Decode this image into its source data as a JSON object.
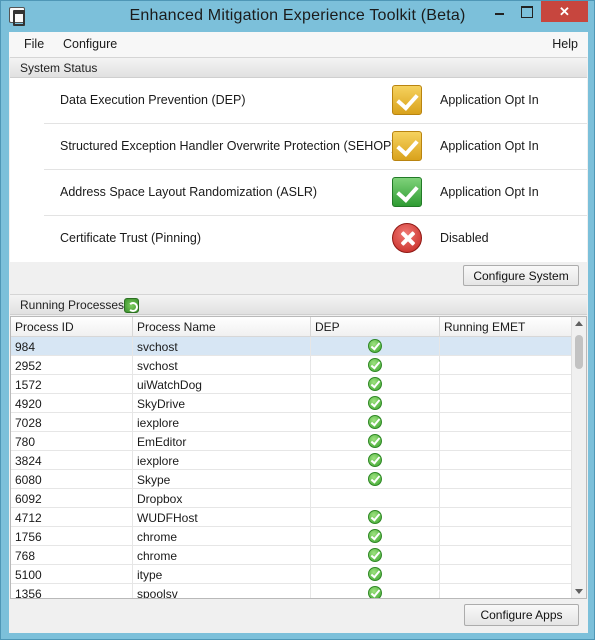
{
  "window": {
    "title": "Enhanced Mitigation Experience Toolkit (Beta)",
    "close_glyph": "✕"
  },
  "menu": {
    "file": "File",
    "configure": "Configure",
    "help": "Help"
  },
  "system_status": {
    "header": "System Status",
    "items": [
      {
        "label": "Data Execution Prevention (DEP)",
        "value": "Application Opt In",
        "icon": "yellow-check-icon"
      },
      {
        "label": "Structured Exception Handler Overwrite Protection (SEHOP)",
        "value": "Application Opt In",
        "icon": "yellow-check-icon"
      },
      {
        "label": "Address Space Layout Randomization (ASLR)",
        "value": "Application Opt In",
        "icon": "green-check-icon"
      },
      {
        "label": "Certificate Trust (Pinning)",
        "value": "Disabled",
        "icon": "red-x-icon"
      }
    ],
    "configure_button": "Configure System"
  },
  "running_processes": {
    "header": "Running Processes",
    "columns": [
      "Process ID",
      "Process Name",
      "DEP",
      "Running EMET"
    ],
    "rows": [
      {
        "pid": "984",
        "name": "svchost",
        "dep": true,
        "emet": ""
      },
      {
        "pid": "2952",
        "name": "svchost",
        "dep": true,
        "emet": ""
      },
      {
        "pid": "1572",
        "name": "uiWatchDog",
        "dep": true,
        "emet": ""
      },
      {
        "pid": "4920",
        "name": "SkyDrive",
        "dep": true,
        "emet": ""
      },
      {
        "pid": "7028",
        "name": "iexplore",
        "dep": true,
        "emet": ""
      },
      {
        "pid": "780",
        "name": "EmEditor",
        "dep": true,
        "emet": ""
      },
      {
        "pid": "3824",
        "name": "iexplore",
        "dep": true,
        "emet": ""
      },
      {
        "pid": "6080",
        "name": "Skype",
        "dep": true,
        "emet": ""
      },
      {
        "pid": "6092",
        "name": "Dropbox",
        "dep": false,
        "emet": ""
      },
      {
        "pid": "4712",
        "name": "WUDFHost",
        "dep": true,
        "emet": ""
      },
      {
        "pid": "1756",
        "name": "chrome",
        "dep": true,
        "emet": ""
      },
      {
        "pid": "768",
        "name": "chrome",
        "dep": true,
        "emet": ""
      },
      {
        "pid": "5100",
        "name": "itype",
        "dep": true,
        "emet": ""
      },
      {
        "pid": "1356",
        "name": "spoolsv",
        "dep": true,
        "emet": ""
      }
    ],
    "configure_button": "Configure Apps"
  }
}
